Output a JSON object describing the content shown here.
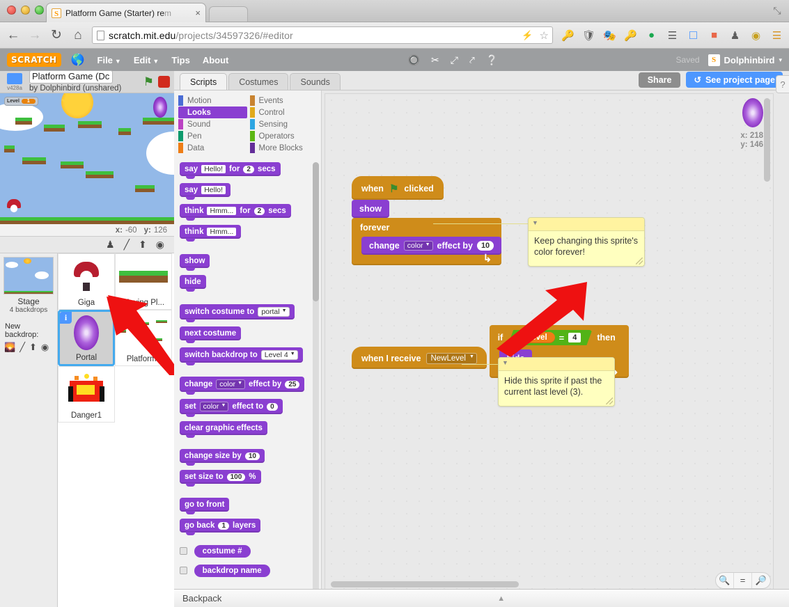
{
  "browser": {
    "tab_title": "Platform Game (Starter) re",
    "tab_title_dim": "m",
    "tab_close": "×",
    "back": "←",
    "forward": "→",
    "reload": "↻",
    "home": "⌂",
    "url_domain": "scratch.mit.edu",
    "url_path": "/projects/34597326/#editor",
    "star": "☆",
    "bolt": "⚡",
    "window_restore": "⤡",
    "extensions": [
      "key-icon",
      "shield-down-icon",
      "mask-icon",
      "key2-icon",
      "green-chat-icon",
      "layers-icon",
      "screenshot-icon",
      "k-icon",
      "ninja-icon",
      "owl-icon",
      "hamburger-menu-icon"
    ]
  },
  "scratch_menu": {
    "logo": "SCRATCH",
    "globe_icon": "🌐",
    "items": [
      "File",
      "Edit",
      "Tips",
      "About"
    ],
    "has_caret": [
      true,
      true,
      false,
      false
    ],
    "tools": [
      "stamp-icon",
      "scissors-icon",
      "grow-icon",
      "shrink-icon",
      "help-icon"
    ],
    "tool_glyphs": [
      "⛏",
      "✂",
      "⤡",
      "⤢",
      "?"
    ],
    "saved_label": "Saved",
    "username": "Dolphinbird",
    "user_caret": "▾",
    "avatar_letter": "S"
  },
  "stage_header": {
    "version": "v428a",
    "project_title": "Platform Game (Dc",
    "byline": "by Dolphinbird (unshared)",
    "green_flag_icon": "⚑",
    "stop_icon": "stop-button"
  },
  "stage": {
    "level_watcher_name": "Level",
    "level_watcher_value": "1",
    "mouse_x_label": "x:",
    "mouse_x": "-60",
    "mouse_y_label": "y:",
    "mouse_y": "126"
  },
  "sprite_panel": {
    "toolbar_icons": [
      "new-sprite-icon",
      "paint-sprite-icon",
      "upload-sprite-icon",
      "camera-sprite-icon"
    ],
    "toolbar_glyphs": [
      "♟",
      "/",
      "⬆",
      "◉"
    ],
    "stage_label": "Stage",
    "stage_sub": "4 backdrops",
    "new_backdrop_label": "New backdrop:",
    "backdrop_icons": [
      "library-backdrop-icon",
      "paint-backdrop-icon",
      "upload-backdrop-icon",
      "camera-backdrop-icon"
    ],
    "backdrop_glyphs": [
      "⛰",
      "/",
      "⬆",
      "◉"
    ],
    "sprites": [
      {
        "name": "Giga",
        "selected": false,
        "info_badge": false
      },
      {
        "name": "Moving Pl...",
        "selected": false,
        "info_badge": false
      },
      {
        "name": "Portal",
        "selected": true,
        "info_badge": true,
        "badge": "i"
      },
      {
        "name": "Platforms",
        "selected": false,
        "info_badge": false
      },
      {
        "name": "Danger1",
        "selected": false,
        "info_badge": false
      }
    ]
  },
  "editor_tabs": {
    "tabs": [
      "Scripts",
      "Costumes",
      "Sounds"
    ],
    "active": "Scripts",
    "share_label": "Share",
    "project_page_label": "See project page",
    "project_page_icon": "↺"
  },
  "palette": {
    "categories": [
      {
        "label": "Motion",
        "color": "#4a6cd4",
        "active": false
      },
      {
        "label": "Events",
        "color": "#c88330",
        "active": false
      },
      {
        "label": "Looks",
        "color": "#8a3fd1",
        "active": true
      },
      {
        "label": "Control",
        "color": "#e1a91a",
        "active": false
      },
      {
        "label": "Sound",
        "color": "#bb42c3",
        "active": false
      },
      {
        "label": "Sensing",
        "color": "#2ca5e2",
        "active": false
      },
      {
        "label": "Pen",
        "color": "#0e9a6c",
        "active": false
      },
      {
        "label": "Operators",
        "color": "#5cb712",
        "active": false
      },
      {
        "label": "Data",
        "color": "#ee7d16",
        "active": false
      },
      {
        "label": "More Blocks",
        "color": "#632d99",
        "active": false
      }
    ],
    "blocks": [
      {
        "id": "say-for-secs",
        "parts": [
          {
            "t": "label",
            "v": "say"
          },
          {
            "t": "text",
            "v": "Hello!"
          },
          {
            "t": "label",
            "v": "for"
          },
          {
            "t": "num",
            "v": "2"
          },
          {
            "t": "label",
            "v": "secs"
          }
        ]
      },
      {
        "id": "say",
        "parts": [
          {
            "t": "label",
            "v": "say"
          },
          {
            "t": "text",
            "v": "Hello!"
          }
        ]
      },
      {
        "id": "think-for-secs",
        "parts": [
          {
            "t": "label",
            "v": "think"
          },
          {
            "t": "text",
            "v": "Hmm..."
          },
          {
            "t": "label",
            "v": "for"
          },
          {
            "t": "num",
            "v": "2"
          },
          {
            "t": "label",
            "v": "secs"
          }
        ]
      },
      {
        "id": "think",
        "parts": [
          {
            "t": "label",
            "v": "think"
          },
          {
            "t": "text",
            "v": "Hmm..."
          }
        ]
      },
      {
        "id": "gap"
      },
      {
        "id": "show",
        "parts": [
          {
            "t": "label",
            "v": "show"
          }
        ]
      },
      {
        "id": "hide",
        "parts": [
          {
            "t": "label",
            "v": "hide"
          }
        ]
      },
      {
        "id": "gap"
      },
      {
        "id": "switch-costume",
        "parts": [
          {
            "t": "label",
            "v": "switch costume to"
          },
          {
            "t": "drop",
            "v": "portal"
          }
        ]
      },
      {
        "id": "next-costume",
        "parts": [
          {
            "t": "label",
            "v": "next costume"
          }
        ]
      },
      {
        "id": "switch-backdrop",
        "parts": [
          {
            "t": "label",
            "v": "switch backdrop to"
          },
          {
            "t": "drop",
            "v": "Level 4"
          }
        ]
      },
      {
        "id": "gap"
      },
      {
        "id": "change-effect",
        "parts": [
          {
            "t": "label",
            "v": "change"
          },
          {
            "t": "drop",
            "v": "color"
          },
          {
            "t": "label",
            "v": "effect by"
          },
          {
            "t": "num",
            "v": "25"
          }
        ]
      },
      {
        "id": "set-effect",
        "parts": [
          {
            "t": "label",
            "v": "set"
          },
          {
            "t": "drop",
            "v": "color"
          },
          {
            "t": "label",
            "v": "effect to"
          },
          {
            "t": "num",
            "v": "0"
          }
        ]
      },
      {
        "id": "clear-effects",
        "parts": [
          {
            "t": "label",
            "v": "clear graphic effects"
          }
        ]
      },
      {
        "id": "gap"
      },
      {
        "id": "change-size",
        "parts": [
          {
            "t": "label",
            "v": "change size by"
          },
          {
            "t": "num",
            "v": "10"
          }
        ]
      },
      {
        "id": "set-size",
        "parts": [
          {
            "t": "label",
            "v": "set size to"
          },
          {
            "t": "num",
            "v": "100"
          },
          {
            "t": "label",
            "v": "%"
          }
        ]
      },
      {
        "id": "gap"
      },
      {
        "id": "go-to-front",
        "parts": [
          {
            "t": "label",
            "v": "go to front"
          }
        ]
      },
      {
        "id": "go-back-layers",
        "parts": [
          {
            "t": "label",
            "v": "go back"
          },
          {
            "t": "num",
            "v": "1"
          },
          {
            "t": "label",
            "v": "layers"
          }
        ]
      }
    ],
    "reporters": [
      {
        "id": "costume-number",
        "label": "costume #",
        "checked": false
      },
      {
        "id": "backdrop-name",
        "label": "backdrop name",
        "checked": false
      }
    ]
  },
  "sprite_info": {
    "x_label": "x:",
    "x_value": "218",
    "y_label": "y:",
    "y_value": "146"
  },
  "scripts": [
    {
      "id": "script-green-flag",
      "hat": {
        "pre": "when",
        "icon": "green-flag-icon",
        "post": "clicked"
      },
      "blocks": [
        {
          "type": "stack",
          "label": "show"
        }
      ],
      "loop": {
        "label": "forever",
        "inner": [
          {
            "label_pre": "change",
            "dropdown": "color",
            "label_mid": "effect by",
            "value": "10"
          }
        ]
      },
      "comment": {
        "text": "Keep changing this sprite's color forever!"
      }
    },
    {
      "id": "script-when-i-receive",
      "hat": {
        "pre": "when I receive",
        "dropdown": "NewLevel"
      },
      "if_block": {
        "label_if": "if",
        "operand_left": "Level",
        "operator": "=",
        "operand_right": "4",
        "label_then": "then",
        "inner": [
          {
            "type": "stack",
            "label": "hide"
          }
        ]
      },
      "comment": {
        "text": "Hide this sprite if past the current last level (3)."
      }
    }
  ],
  "zoom_controls": {
    "zoom_out": "zoom-out-icon",
    "zoom_reset": "zoom-reset-icon",
    "zoom_in": "zoom-in-icon",
    "glyphs": [
      "⊖",
      "=",
      "⊕"
    ]
  },
  "backpack": {
    "label": "Backpack",
    "caret": "▲"
  },
  "help_tab": {
    "glyph": "?"
  },
  "colors": {
    "looks_purple": "#8a3fd1",
    "events_orange": "#cf8c1a",
    "control_yellow": "#e1a91a",
    "operators_green": "#52b317",
    "data_orange": "#ee7d16",
    "accent_blue": "#4d97ff",
    "comment_yellow": "#ffffbf",
    "arrow_red": "#ee1111",
    "scratch_orange": "#f90"
  }
}
